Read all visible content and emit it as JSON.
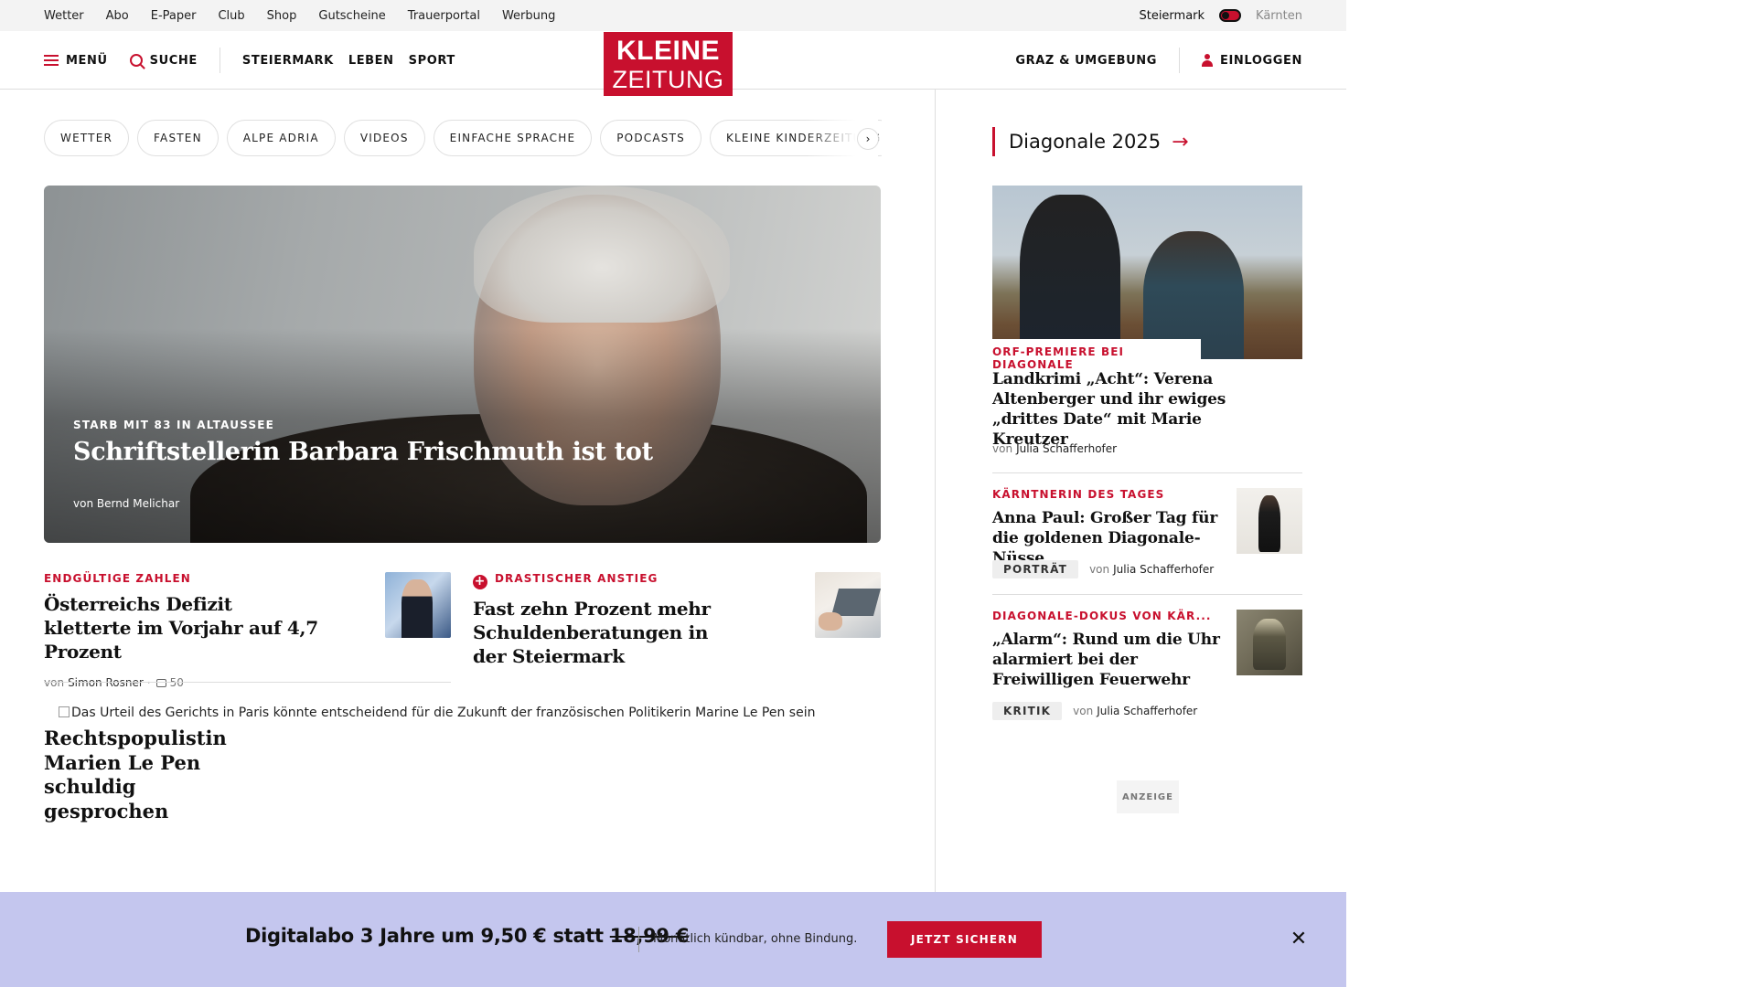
{
  "utility": {
    "links": [
      "Wetter",
      "Abo",
      "E-Paper",
      "Club",
      "Shop",
      "Gutscheine",
      "Trauerportal",
      "Werbung"
    ],
    "region_active": "Steiermark",
    "region_inactive": "Kärnten"
  },
  "header": {
    "menu_label": "MENÜ",
    "search_label": "SUCHE",
    "nav": [
      "STEIERMARK",
      "LEBEN",
      "SPORT"
    ],
    "logo_line1": "KLEINE",
    "logo_line2": "ZEITUNG",
    "local_label": "GRAZ & UMGEBUNG",
    "login_label": "EINLOGGEN"
  },
  "pills": [
    "WETTER",
    "FASTEN",
    "ALPE ADRIA",
    "VIDEOS",
    "EINFACHE SPRACHE",
    "PODCASTS",
    "KLEINE KINDERZEITUNG"
  ],
  "pill_arrow": "›",
  "hero": {
    "kicker": "STARB MIT 83 IN ALTAUSSEE",
    "title": "Schriftstellerin Barbara Frischmuth ist tot",
    "byline": "von Bernd Melichar"
  },
  "articles": [
    {
      "kicker": "ENDGÜLTIGE ZAHLEN",
      "title": "Österreichs Defizit kletterte im Vorjahr auf 4,7 Prozent",
      "by_prefix": "von",
      "author": "Simon Rosner",
      "comments": "50"
    },
    {
      "plus": "+",
      "kicker": "DRASTISCHER ANSTIEG",
      "title": "Fast zehn Prozent mehr Schuldenberatungen in der Steiermark"
    }
  ],
  "lepen": {
    "alt_text": "Das Urteil des Gerichts in Paris könnte entscheidend für die Zukunft der französischen Politikerin Marine Le Pen sein",
    "title": "Rechtspopulistin Marien Le Pen schuldig gesprochen"
  },
  "sidebar": {
    "section_title": "Diagonale 2025",
    "section_arrow": "→",
    "feature": {
      "kicker": "ORF-PREMIERE BEI DIAGONALE",
      "title": "Landkrimi „Acht“: Verena Altenberger und ihr ewiges „drittes Date“ mit Marie Kreutzer",
      "by_prefix": "von",
      "author": "Julia Schafferhofer"
    },
    "items": [
      {
        "kicker": "KÄRNTNERIN DES TAGES",
        "title": "Anna Paul: Großer Tag für die goldenen Diagonale-Nüsse",
        "badge": "PORTRÄT",
        "by_prefix": "von",
        "author": "Julia Schafferhofer"
      },
      {
        "kicker": "DIAGONALE-DOKUS VON KÄR...",
        "title": "„Alarm“: Rund um die Uhr alarmiert bei der Freiwilligen Feuerwehr",
        "badge": "KRITIK",
        "by_prefix": "von",
        "author": "Julia Schafferhofer"
      }
    ],
    "ad_label": "ANZEIGE"
  },
  "promo": {
    "headline_main": "Digitalabo 3 Jahre um 9,50 € statt",
    "headline_old_price": "18,99 €",
    "subline": "Monatlich kündbar, ohne Bindung.",
    "cta_label": "JETZT SICHERN",
    "close_symbol": "✕"
  },
  "colors": {
    "brand_red": "#c8102e",
    "promo_bg": "#c4c6ee"
  }
}
